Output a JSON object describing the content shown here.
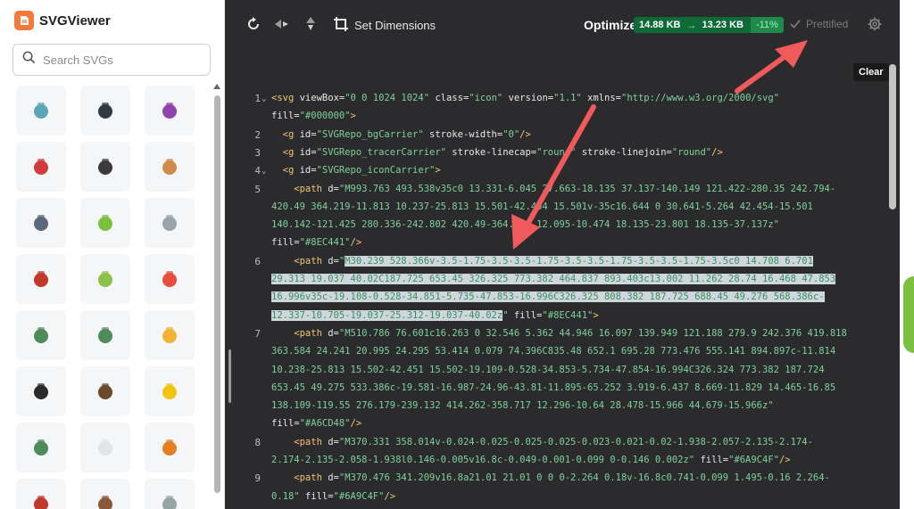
{
  "app": {
    "name": "SVGViewer"
  },
  "search": {
    "placeholder": "Search SVGs"
  },
  "toolbar": {
    "set_dimensions": "Set Dimensions",
    "optimize_label": "Optimize",
    "size_before": "14.88 KB",
    "size_after": "13.23 KB",
    "savings": "-11%",
    "prettified": "Prettified",
    "clear_tooltip": "Clear"
  },
  "sidebar_icons": [
    {
      "name": "teapot-icon",
      "color": "#5aa6b8"
    },
    {
      "name": "television-icon",
      "color": "#2f3a44"
    },
    {
      "name": "taurus-icon",
      "color": "#8e44ad"
    },
    {
      "name": "telephone-icon",
      "color": "#d23b3b"
    },
    {
      "name": "telescope-icon",
      "color": "#3b3b3b"
    },
    {
      "name": "teacher-icon",
      "color": "#d08a4a"
    },
    {
      "name": "technologist-icon",
      "color": "#5a6a7a"
    },
    {
      "name": "teacup-icon",
      "color": "#7cc040"
    },
    {
      "name": "clock-icon",
      "color": "#9aa4ad"
    },
    {
      "name": "ninja-icon",
      "color": "#c0392b"
    },
    {
      "name": "tennis-ball-icon",
      "color": "#8bc34a"
    },
    {
      "name": "sushi-icon",
      "color": "#e74c3c"
    },
    {
      "name": "teacher-woman-icon",
      "color": "#4e8b5a"
    },
    {
      "name": "teacher-man-icon",
      "color": "#4e8b5a"
    },
    {
      "name": "sunrise-icon",
      "color": "#f2b233"
    },
    {
      "name": "phone-receiver-icon",
      "color": "#2b2b2b"
    },
    {
      "name": "teacher-dark-icon",
      "color": "#6a4a2a"
    },
    {
      "name": "construction-worker-icon",
      "color": "#f1c40f"
    },
    {
      "name": "blackboard-icon",
      "color": "#4e8b5a"
    },
    {
      "name": "swan-icon",
      "color": "#dfe6ea"
    },
    {
      "name": "tram-icon",
      "color": "#e67e22"
    },
    {
      "name": "takeout-cup-icon",
      "color": "#c0392b"
    },
    {
      "name": "person-icon",
      "color": "#8b5a3c"
    },
    {
      "name": "syringe-icon",
      "color": "#95a5a6"
    }
  ],
  "code": {
    "lines": [
      {
        "num": "1",
        "fold": true,
        "segments": [
          [
            "tag",
            "<svg "
          ],
          [
            "attr",
            "viewBox="
          ],
          [
            "str",
            "\"0 0 1024 1024\""
          ],
          [
            "attr",
            " class="
          ],
          [
            "str",
            "\"icon\""
          ],
          [
            "attr",
            " version="
          ],
          [
            "str",
            "\"1.1\""
          ],
          [
            "attr",
            " xmlns="
          ],
          [
            "str",
            "\"http://www.w3.org/2000/svg\""
          ]
        ]
      },
      {
        "num": "",
        "fold": false,
        "segments": [
          [
            "attr",
            "fill="
          ],
          [
            "str",
            "\"#000000\""
          ],
          [
            "tag",
            ">"
          ]
        ]
      },
      {
        "num": "2",
        "fold": false,
        "segments": [
          [
            "tag",
            "  <g "
          ],
          [
            "attr",
            "id="
          ],
          [
            "str",
            "\"SVGRepo_bgCarrier\""
          ],
          [
            "attr",
            " stroke-width="
          ],
          [
            "str",
            "\"0\""
          ],
          [
            "tag",
            "/>"
          ]
        ]
      },
      {
        "num": "3",
        "fold": false,
        "segments": [
          [
            "tag",
            "  <g "
          ],
          [
            "attr",
            "id="
          ],
          [
            "str",
            "\"SVGRepo_tracerCarrier\""
          ],
          [
            "attr",
            " stroke-linecap="
          ],
          [
            "str",
            "\"round\""
          ],
          [
            "attr",
            " stroke-linejoin="
          ],
          [
            "str",
            "\"round\""
          ],
          [
            "tag",
            "/>"
          ]
        ]
      },
      {
        "num": "4",
        "fold": true,
        "segments": [
          [
            "tag",
            "  <g "
          ],
          [
            "attr",
            "id="
          ],
          [
            "str",
            "\"SVGRepo_iconCarrier\""
          ],
          [
            "tag",
            ">"
          ]
        ]
      },
      {
        "num": "5",
        "fold": false,
        "segments": [
          [
            "tag",
            "    <path "
          ],
          [
            "attr",
            "d="
          ],
          [
            "str",
            "\"M993.763 493.538v35c0 13.331-6.045 27.663-18.135 37.137-140.149 121.422-280.35 242.794-"
          ]
        ]
      },
      {
        "num": "",
        "fold": false,
        "segments": [
          [
            "str",
            "420.49 364.219-11.813 10.237-25.813 15.501-42.454 15.501v-35c16.644 0 30.641-5.264 42.454-15.501"
          ]
        ]
      },
      {
        "num": "",
        "fold": false,
        "segments": [
          [
            "str",
            "140.142-121.425 280.336-242.802 420.49-364.224 12.095-10.474 18.135-23.801 18.135-37.137z\""
          ]
        ]
      },
      {
        "num": "",
        "fold": false,
        "segments": [
          [
            "attr",
            "fill="
          ],
          [
            "str",
            "\"#8EC441\""
          ],
          [
            "tag",
            "/>"
          ]
        ]
      },
      {
        "num": "6",
        "fold": false,
        "segments": [
          [
            "tag",
            "    <path "
          ],
          [
            "attr",
            "d="
          ],
          [
            "str",
            "\""
          ],
          [
            "hl",
            "M30.239 528.366v-3.5-1.75-3.5-3.5-1.75-3.5-3.5-1.75-3.5-3.5-1.75-3.5c0 14.708 6.701"
          ]
        ]
      },
      {
        "num": "",
        "fold": false,
        "segments": [
          [
            "hl",
            "29.313 19.037 40.02C187.725 653.45 326.325 773.382 464.837 893.403c13.002 11.262 28.74 16.468 47.853"
          ]
        ]
      },
      {
        "num": "",
        "fold": false,
        "segments": [
          [
            "hl",
            "16.996v35c-19.108-0.528-34.851-5.735-47.853-16.996C326.325 808.382 187.725 688.45 49.276 568.386c-"
          ]
        ]
      },
      {
        "num": "",
        "fold": false,
        "segments": [
          [
            "hl",
            "12.337-10.705-19.037-25.312-19.037-40.02z"
          ],
          [
            "str",
            "\""
          ],
          [
            "attr",
            " fill="
          ],
          [
            "str",
            "\"#8EC441\""
          ],
          [
            "tag",
            ">"
          ]
        ]
      },
      {
        "num": "7",
        "fold": false,
        "segments": [
          [
            "tag",
            "    <path "
          ],
          [
            "attr",
            "d="
          ],
          [
            "str",
            "\"M510.786 76.601c16.263 0 32.546 5.362 44.946 16.097 139.949 121.188 279.9 242.376 419.818"
          ]
        ]
      },
      {
        "num": "",
        "fold": false,
        "segments": [
          [
            "str",
            "363.584 24.241 20.995 24.295 53.414 0.079 74.396C835.48 652.1 695.28 773.476 555.141 894.897c-11.814"
          ]
        ]
      },
      {
        "num": "",
        "fold": false,
        "segments": [
          [
            "str",
            "10.238-25.813 15.502-42.451 15.502-19.109-0.528-34.853-5.734-47.854-16.994C326.324 773.382 187.724"
          ]
        ]
      },
      {
        "num": "",
        "fold": false,
        "segments": [
          [
            "str",
            "653.45 49.275 533.386c-19.581-16.987-24.96-43.81-11.895-65.252 3.919-6.437 8.669-11.829 14.465-16.85"
          ]
        ]
      },
      {
        "num": "",
        "fold": false,
        "segments": [
          [
            "str",
            "138.109-119.55 276.179-239.132 414.262-358.717 12.296-10.64 28.478-15.966 44.679-15.966z\""
          ]
        ]
      },
      {
        "num": "",
        "fold": false,
        "segments": [
          [
            "attr",
            "fill="
          ],
          [
            "str",
            "\"#A6CD48\""
          ],
          [
            "tag",
            "/>"
          ]
        ]
      },
      {
        "num": "8",
        "fold": false,
        "segments": [
          [
            "tag",
            "    <path "
          ],
          [
            "attr",
            "d="
          ],
          [
            "str",
            "\"M370.331 358.014v-0.024-0.025-0.025-0.025-0.023-0.021-0.02-1.938-2.057-2.135-2.174-"
          ]
        ]
      },
      {
        "num": "",
        "fold": false,
        "segments": [
          [
            "str",
            "2.174-2.135-2.058-1.938l0.146-0.005v16.8c-0.049-0.001-0.099 0-0.146 0.002z\""
          ],
          [
            "attr",
            " fill="
          ],
          [
            "str",
            "\"#6A9C4F\""
          ],
          [
            "tag",
            "/>"
          ]
        ]
      },
      {
        "num": "9",
        "fold": false,
        "segments": [
          [
            "tag",
            "    <path "
          ],
          [
            "attr",
            "d="
          ],
          [
            "str",
            "\"M370.476 341.209v16.8a21.01 21.01 0 0 0-2.264 0.18v-16.8c0.741-0.099 1.495-0.16 2.264-"
          ]
        ]
      },
      {
        "num": "",
        "fold": false,
        "segments": [
          [
            "str",
            "0.18\""
          ],
          [
            "attr",
            " fill="
          ],
          [
            "str",
            "\"#6A9C4F\""
          ],
          [
            "tag",
            "/>"
          ]
        ]
      }
    ]
  },
  "colors": {
    "editor_bg": "#2b2b2d",
    "accent": "#f5793b",
    "annotation_arrow": "#f05a5a",
    "badge_bg": "#0e6b38"
  }
}
